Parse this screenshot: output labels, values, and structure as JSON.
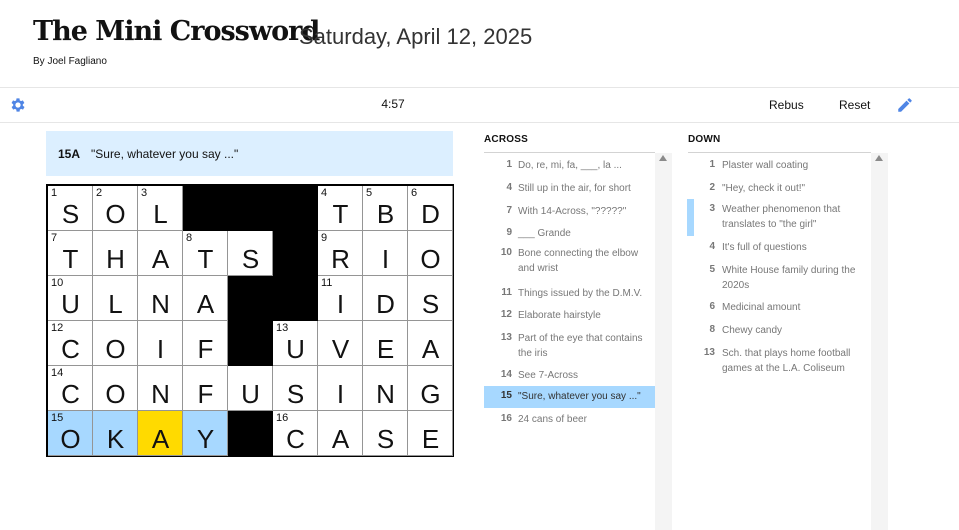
{
  "header": {
    "title": "The Mini Crossword",
    "date": "Saturday, April 12, 2025",
    "byline": "By Joel Fagliano"
  },
  "toolbar": {
    "settings_icon": "gear-icon",
    "timer": "4:57",
    "rebus_label": "Rebus",
    "reset_label": "Reset",
    "pencil_icon": "pencil-icon"
  },
  "colors": {
    "accent": "#4f85e5",
    "word_highlight": "#a7d8ff",
    "active_cell": "#ffda00",
    "clue_bar": "#dcefff"
  },
  "current_clue": {
    "number": "15A",
    "text": "\"Sure, whatever you say ...\""
  },
  "grid": {
    "rows": [
      [
        {
          "n": "1",
          "l": "S"
        },
        {
          "n": "2",
          "l": "O"
        },
        {
          "n": "3",
          "l": "L"
        },
        {
          "b": true
        },
        {
          "b": true
        },
        {
          "b": true
        },
        {
          "n": "4",
          "l": "T"
        },
        {
          "n": "5",
          "l": "B"
        },
        {
          "n": "6",
          "l": "D"
        }
      ],
      [
        {
          "n": "7",
          "l": "T"
        },
        {
          "n": "",
          "l": "H"
        },
        {
          "n": "",
          "l": "A"
        },
        {
          "n": "8",
          "l": "T"
        },
        {
          "n": "",
          "l": "S"
        },
        {
          "b": true
        },
        {
          "n": "9",
          "l": "R"
        },
        {
          "n": "",
          "l": "I"
        },
        {
          "n": "",
          "l": "O"
        }
      ],
      [
        {
          "n": "10",
          "l": "U"
        },
        {
          "n": "",
          "l": "L"
        },
        {
          "n": "",
          "l": "N"
        },
        {
          "n": "",
          "l": "A"
        },
        {
          "b": true
        },
        {
          "b": true
        },
        {
          "n": "11",
          "l": "I"
        },
        {
          "n": "",
          "l": "D"
        },
        {
          "n": "",
          "l": "S"
        }
      ],
      [
        {
          "n": "12",
          "l": "C"
        },
        {
          "n": "",
          "l": "O"
        },
        {
          "n": "",
          "l": "I"
        },
        {
          "n": "",
          "l": "F"
        },
        {
          "b": true
        },
        {
          "n": "13",
          "l": "U"
        },
        {
          "n": "",
          "l": "V"
        },
        {
          "n": "",
          "l": "E"
        },
        {
          "n": "",
          "l": "A"
        }
      ],
      [
        {
          "n": "14",
          "l": "C"
        },
        {
          "n": "",
          "l": "O"
        },
        {
          "n": "",
          "l": "N"
        },
        {
          "n": "",
          "l": "F"
        },
        {
          "n": "",
          "l": "U"
        },
        {
          "n": "",
          "l": "S"
        },
        {
          "n": "",
          "l": "I"
        },
        {
          "n": "",
          "l": "N"
        },
        {
          "n": "",
          "l": "G"
        }
      ],
      [
        {
          "n": "15",
          "l": "O",
          "w": true
        },
        {
          "n": "",
          "l": "K",
          "w": true
        },
        {
          "n": "",
          "l": "A",
          "a": true
        },
        {
          "n": "",
          "l": "Y",
          "w": true
        },
        {
          "b": true
        },
        {
          "n": "16",
          "l": "C"
        },
        {
          "n": "",
          "l": "A"
        },
        {
          "n": "",
          "l": "S"
        },
        {
          "n": "",
          "l": "E"
        }
      ]
    ]
  },
  "across": {
    "heading": "ACROSS",
    "clues": [
      {
        "num": "1",
        "text": "Do, re, mi, fa, ___, la ..."
      },
      {
        "num": "4",
        "text": "Still up in the air, for short"
      },
      {
        "num": "7",
        "text": "With 14-Across, \"?????\""
      },
      {
        "num": "9",
        "text": "___ Grande"
      },
      {
        "num": "10",
        "text": "Bone connecting the elbow and wrist"
      },
      {
        "num": "11",
        "text": "Things issued by the D.M.V."
      },
      {
        "num": "12",
        "text": "Elaborate hairstyle"
      },
      {
        "num": "13",
        "text": "Part of the eye that contains the iris"
      },
      {
        "num": "14",
        "text": "See 7-Across"
      },
      {
        "num": "15",
        "text": "\"Sure, whatever you say ...\"",
        "selected": true
      },
      {
        "num": "16",
        "text": "24 cans of beer"
      }
    ]
  },
  "down": {
    "heading": "DOWN",
    "clues": [
      {
        "num": "1",
        "text": "Plaster wall coating"
      },
      {
        "num": "2",
        "text": "\"Hey, check it out!\""
      },
      {
        "num": "3",
        "text": "Weather phenomenon that translates to \"the girl\"",
        "crossing": true
      },
      {
        "num": "4",
        "text": "It's full of questions"
      },
      {
        "num": "5",
        "text": "White House family during the 2020s"
      },
      {
        "num": "6",
        "text": "Medicinal amount"
      },
      {
        "num": "8",
        "text": "Chewy candy"
      },
      {
        "num": "13",
        "text": "Sch. that plays home football games at the L.A. Coliseum"
      }
    ]
  }
}
